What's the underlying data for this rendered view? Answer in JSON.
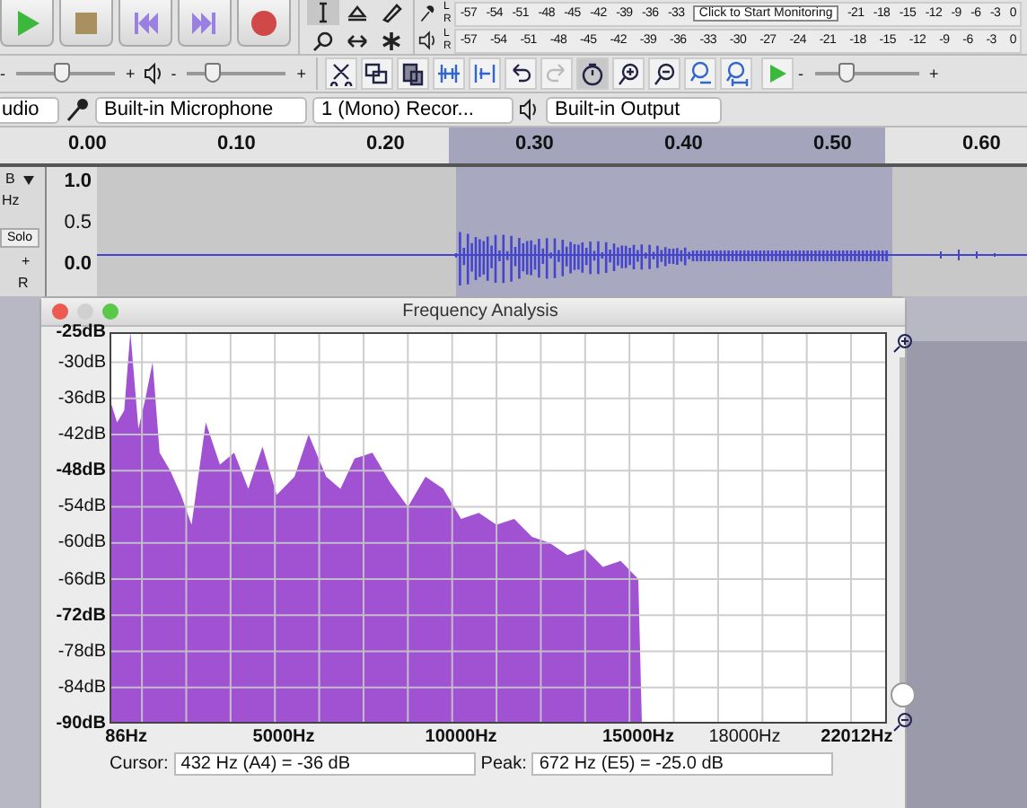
{
  "transport": [
    {
      "kind": "play"
    },
    {
      "kind": "stop"
    },
    {
      "kind": "skip-start"
    },
    {
      "kind": "skip-end"
    },
    {
      "kind": "record"
    }
  ],
  "tools": [
    {
      "kind": "select",
      "selected": true
    },
    {
      "kind": "envelope",
      "selected": false
    },
    {
      "kind": "draw",
      "selected": false
    },
    {
      "kind": "zoom",
      "selected": false
    },
    {
      "kind": "timeshift",
      "selected": false
    },
    {
      "kind": "multi",
      "selected": false
    }
  ],
  "meters": [
    {
      "kind": "record",
      "channels": [
        "L",
        "R"
      ],
      "ticks": [
        "-57",
        "-54",
        "-51",
        "-48",
        "-45",
        "-42",
        "-39",
        "-36",
        "-33"
      ],
      "tooltip": "Click to Start Monitoring",
      "ticks_after": [
        "-21",
        "-18",
        "-15",
        "-12",
        "-9",
        "-6",
        "-3",
        "0"
      ]
    },
    {
      "kind": "play",
      "channels": [
        "L",
        "R"
      ],
      "ticks": [
        "-57",
        "-54",
        "-51",
        "-48",
        "-45",
        "-42",
        "-39",
        "-36",
        "-33",
        "-30",
        "-27",
        "-24",
        "-21",
        "-18",
        "-15",
        "-12",
        "-9",
        "-6",
        "-3",
        "0"
      ]
    }
  ],
  "mixer": [
    {
      "kind": "input",
      "level": 0.45,
      "minus": "-",
      "plus": "+"
    },
    {
      "kind": "output",
      "level": 0.25,
      "minus": "-",
      "plus": "+"
    }
  ],
  "edit_tools": [
    {
      "kind": "cut",
      "disabled": false
    },
    {
      "kind": "copy",
      "disabled": false
    },
    {
      "kind": "paste",
      "disabled": false
    },
    {
      "kind": "trim",
      "disabled": false
    },
    {
      "kind": "silence",
      "disabled": false
    },
    {
      "kind": "undo",
      "disabled": false
    },
    {
      "kind": "redo",
      "disabled": true
    },
    {
      "kind": "sync",
      "disabled": false
    },
    {
      "kind": "zoom-in",
      "disabled": false
    },
    {
      "kind": "zoom-out",
      "disabled": false
    },
    {
      "kind": "fit-selection",
      "disabled": false
    },
    {
      "kind": "fit-project",
      "disabled": false
    }
  ],
  "play_at_speed": {
    "level": 0.3,
    "minus": "-",
    "plus": "+"
  },
  "devices": {
    "host": "udio",
    "input": "Built-in Microphone",
    "channels": "1 (Mono) Recor...",
    "output": "Built-in Output"
  },
  "ruler": [
    "0.00",
    "0.10",
    "0.20",
    "0.30",
    "0.40",
    "0.50",
    "0.60"
  ],
  "track": {
    "name": "B",
    "rate": "Hz",
    "solo": "Solo",
    "gain": "+",
    "pan": "R",
    "scale": [
      "1.0",
      "0.5",
      "0.0"
    ]
  },
  "dialog": {
    "title": "Frequency Analysis",
    "chart_data": {
      "type": "area",
      "grid": true,
      "xlim": [
        86,
        22012
      ],
      "ylim": [
        -90,
        -25
      ],
      "xticks": [
        {
          "value": 86,
          "label": "86Hz"
        },
        {
          "value": 5000,
          "label": "5000Hz"
        },
        {
          "value": 10000,
          "label": "10000Hz"
        },
        {
          "value": 15000,
          "label": "15000Hz"
        },
        {
          "value": 18000,
          "label": "18000Hz"
        },
        {
          "value": 22012,
          "label": "22012Hz"
        }
      ],
      "yticks": [
        {
          "value": -25,
          "label": "-25dB"
        },
        {
          "value": -30,
          "label": "-30dB"
        },
        {
          "value": -36,
          "label": "-36dB"
        },
        {
          "value": -42,
          "label": "-42dB"
        },
        {
          "value": -48,
          "label": "-48dB"
        },
        {
          "value": -54,
          "label": "-54dB"
        },
        {
          "value": -60,
          "label": "-60dB"
        },
        {
          "value": -66,
          "label": "-66dB"
        },
        {
          "value": -72,
          "label": "-72dB"
        },
        {
          "value": -78,
          "label": "-78dB"
        },
        {
          "value": -84,
          "label": "-84dB"
        },
        {
          "value": -90,
          "label": "-90dB"
        }
      ],
      "x": [
        86,
        300,
        500,
        672,
        900,
        1100,
        1300,
        1500,
        1800,
        2100,
        2400,
        2800,
        3200,
        3600,
        4000,
        4400,
        4800,
        5300,
        5700,
        6200,
        6600,
        7000,
        7500,
        8000,
        8500,
        9000,
        9500,
        10000,
        10500,
        11000,
        11500,
        12000,
        12500,
        13000,
        13500,
        14000,
        14500,
        15000,
        15100
      ],
      "series": [
        {
          "color": "#a052d2",
          "values": [
            -36,
            -40,
            -38,
            -25,
            -41,
            -36,
            -30,
            -45,
            -48,
            -52,
            -57,
            -40,
            -47,
            -45,
            -51,
            -44,
            -52,
            -49,
            -42,
            -49,
            -51,
            -46,
            -45,
            -50,
            -54,
            -49,
            -51,
            -56,
            -55,
            -57,
            -56,
            -59,
            -60,
            -62,
            -61,
            -64,
            -63,
            -66,
            -90
          ]
        }
      ]
    },
    "zoom_slider": {
      "level": 0
    },
    "cursor_label": "Cursor:",
    "cursor": "432 Hz (A4) = -36 dB",
    "peak_label": "Peak:",
    "peak": "672 Hz (E5) = -25.0 dB"
  }
}
